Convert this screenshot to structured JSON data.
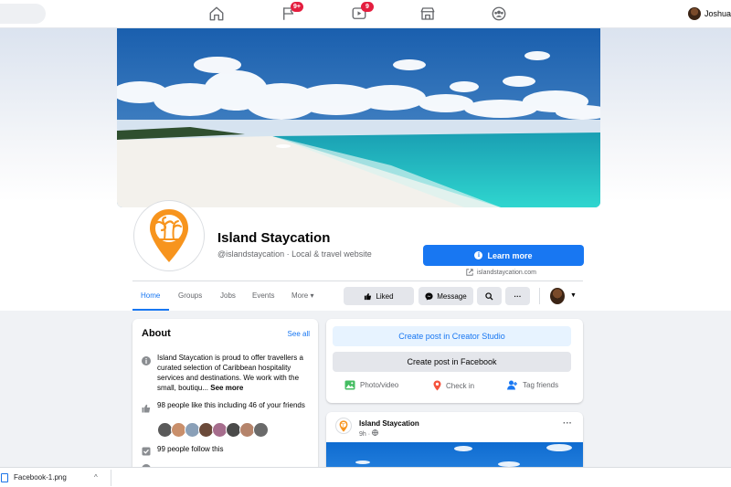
{
  "topnav": {
    "badges": {
      "pages": "9+",
      "watch": "9"
    },
    "user_name": "Joshua"
  },
  "page": {
    "name": "Island Staycation",
    "subtitle": "@islandstaycation · Local & travel website",
    "cta_label": "Learn more",
    "website": "islandstaycation.com"
  },
  "tabs": [
    "Home",
    "Groups",
    "Jobs",
    "Events",
    "More"
  ],
  "actions": {
    "liked": "Liked",
    "message": "Message"
  },
  "about": {
    "title": "About",
    "see_all": "See all",
    "description": "Island Staycation is proud to offer travellers a curated selection of Caribbean hospitality services and destinations. We work with the small, boutiqu...",
    "see_more": "See more",
    "likes": "98 people like this including 46 of your friends",
    "follows": "99 people follow this"
  },
  "creator": {
    "studio_label": "Create post in Creator Studio",
    "facebook_label": "Create post in Facebook",
    "photo_video": "Photo/video",
    "check_in": "Check in",
    "tag_friends": "Tag friends"
  },
  "post": {
    "author": "Island Staycation",
    "time": "9h ·"
  },
  "download": {
    "filename": "Facebook-1.png"
  },
  "colors": {
    "accent": "#1877f2",
    "badge": "#e41e3f",
    "logo_orange": "#f7941d"
  }
}
